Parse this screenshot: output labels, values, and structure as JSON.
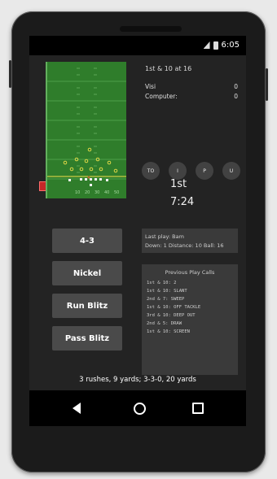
{
  "status_bar": {
    "time": "6:05"
  },
  "scoreboard": {
    "situation": "1st & 10 at 16",
    "teams": [
      {
        "name": "Visi",
        "score": "0"
      },
      {
        "name": "Computer:",
        "score": "0"
      }
    ]
  },
  "timeouts": [
    "TO",
    "I",
    "P",
    "U"
  ],
  "game_clock": {
    "quarter": "1st",
    "time": "7:24"
  },
  "defense_buttons": [
    "4-3",
    "Nickel",
    "Run Blitz",
    "Pass Blitz"
  ],
  "last_play": {
    "line1": "Last play: Bam",
    "line2": "Down: 1 Distance: 10 Ball: 16"
  },
  "previous_plays": {
    "title": "Previous Play Calls",
    "items": [
      "1st & 10:  2",
      "1st & 10:  SLANT",
      "2nd &  7:  SWEEP",
      "1st & 10:  OFF TACKLE",
      "3rd & 10:  DEEP OUT",
      "2nd &  5:  DRAW",
      "1st & 10:  SCREEN"
    ]
  },
  "summary": "3 rushes, 9 yards; 3-3-0, 20 yards",
  "field": {
    "yard_markers": [
      "10",
      "20",
      "30",
      "40",
      "50"
    ],
    "turf_color": "#2f7d2b",
    "end_marker_color": "#c62828"
  }
}
